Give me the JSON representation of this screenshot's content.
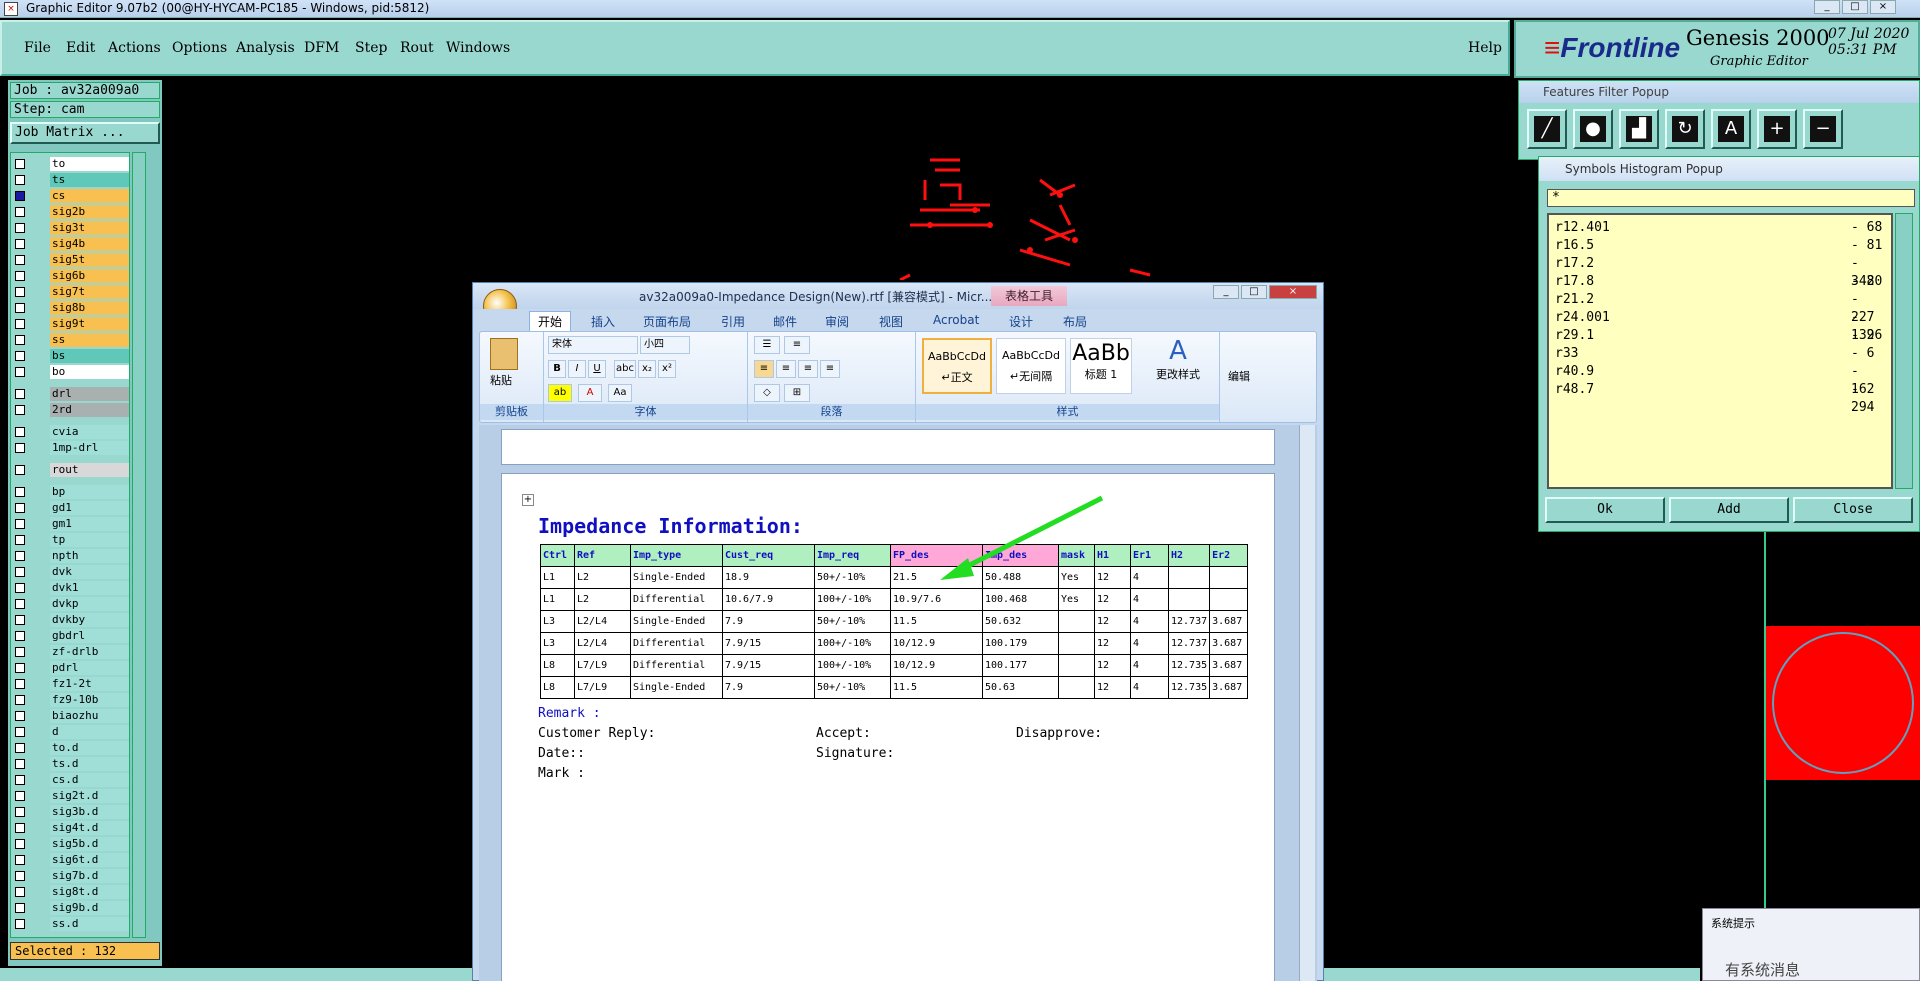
{
  "window": {
    "title": "Graphic Editor 9.07b2 (00@HY-HYCAM-PC185 - Windows, pid:5812)"
  },
  "menubar": {
    "items": [
      "File",
      "Edit",
      "Actions",
      "Options",
      "Analysis",
      "DFM",
      "Step",
      "Rout",
      "Windows"
    ],
    "help": "Help"
  },
  "brand": {
    "logo": "Frontline",
    "product": "Genesis 2000",
    "subtitle": "Graphic Editor",
    "date": "07 Jul 2020",
    "time": "05:31 PM"
  },
  "left": {
    "job": "Job : av32a009a0",
    "step": "Step: cam",
    "matrix": "Job Matrix ...",
    "selected": "Selected : 132",
    "layers": [
      {
        "name": "to",
        "color": "white",
        "mark": "⬋"
      },
      {
        "name": "ts",
        "color": "teal",
        "mark": ""
      },
      {
        "name": "cs",
        "color": "org",
        "mark": "≡",
        "on": true
      },
      {
        "name": "sig2b",
        "color": "org",
        "mark": ""
      },
      {
        "name": "sig3t",
        "color": "org",
        "mark": ""
      },
      {
        "name": "sig4b",
        "color": "org",
        "mark": ""
      },
      {
        "name": "sig5t",
        "color": "org",
        "mark": "⬋"
      },
      {
        "name": "sig6b",
        "color": "org",
        "mark": "⬋"
      },
      {
        "name": "sig7t",
        "color": "org",
        "mark": ""
      },
      {
        "name": "sig8b",
        "color": "org",
        "mark": ""
      },
      {
        "name": "sig9t",
        "color": "org",
        "mark": ""
      },
      {
        "name": "ss",
        "color": "org",
        "mark": ""
      },
      {
        "name": "bs",
        "color": "teal",
        "mark": ""
      },
      {
        "name": "bo",
        "color": "white",
        "mark": "⬋"
      },
      {
        "name": "drl",
        "color": "grey",
        "mark": ""
      },
      {
        "name": "2rd",
        "color": "grey",
        "mark": ""
      },
      {
        "name": "cvia",
        "color": "cyan",
        "mark": ""
      },
      {
        "name": "1mp-drl",
        "color": "cyan",
        "mark": ""
      },
      {
        "name": "rout",
        "color": "lgrey",
        "mark": ""
      },
      {
        "name": "bp",
        "color": "cyan",
        "mark": ""
      },
      {
        "name": "gd1",
        "color": "cyan",
        "mark": "⬋"
      },
      {
        "name": "gm1",
        "color": "cyan",
        "mark": ""
      },
      {
        "name": "tp",
        "color": "cyan",
        "mark": ""
      },
      {
        "name": "npth",
        "color": "cyan",
        "mark": ""
      },
      {
        "name": "dvk",
        "color": "cyan",
        "mark": ""
      },
      {
        "name": "dvk1",
        "color": "cyan",
        "mark": ""
      },
      {
        "name": "dvkp",
        "color": "cyan",
        "mark": ""
      },
      {
        "name": "dvkby",
        "color": "cyan",
        "mark": ""
      },
      {
        "name": "gbdrl",
        "color": "cyan",
        "mark": ""
      },
      {
        "name": "zf-drlb",
        "color": "cyan",
        "mark": ""
      },
      {
        "name": "pdrl",
        "color": "cyan",
        "mark": ""
      },
      {
        "name": "fz1-2t",
        "color": "cyan",
        "mark": ""
      },
      {
        "name": "fz9-10b",
        "color": "cyan",
        "mark": ""
      },
      {
        "name": "biaozhu",
        "color": "cyan",
        "mark": ""
      },
      {
        "name": "d",
        "color": "cyan",
        "mark": ""
      },
      {
        "name": "to.d",
        "color": "cyan",
        "mark": "⬋"
      },
      {
        "name": "ts.d",
        "color": "cyan",
        "mark": ""
      },
      {
        "name": "cs.d",
        "color": "cyan",
        "mark": ""
      },
      {
        "name": "sig2t.d",
        "color": "cyan",
        "mark": ""
      },
      {
        "name": "sig3b.d",
        "color": "cyan",
        "mark": ""
      },
      {
        "name": "sig4t.d",
        "color": "cyan",
        "mark": ""
      },
      {
        "name": "sig5b.d",
        "color": "cyan",
        "mark": "⬋"
      },
      {
        "name": "sig6t.d",
        "color": "cyan",
        "mark": "⬋"
      },
      {
        "name": "sig7b.d",
        "color": "cyan",
        "mark": ""
      },
      {
        "name": "sig8t.d",
        "color": "cyan",
        "mark": ""
      },
      {
        "name": "sig9b.d",
        "color": "cyan",
        "mark": ""
      },
      {
        "name": "ss.d",
        "color": "cyan",
        "mark": ""
      }
    ]
  },
  "word": {
    "doc_title": "av32a009a0-Impedance Design(New).rtf [兼容模式] - Micr...",
    "context_tab": "表格工具",
    "tabs": [
      "开始",
      "插入",
      "页面布局",
      "引用",
      "邮件",
      "审阅",
      "视图",
      "Acrobat",
      "设计",
      "布局"
    ],
    "ribbon": {
      "paste": "粘贴",
      "clipboard": "剪贴板",
      "font_name": "宋体",
      "font_size": "小四",
      "font_group": "字体",
      "para_group": "段落",
      "styles_group": "样式",
      "style1_preview": "AaBbCcDd",
      "style1_name": "↵正文",
      "style2_preview": "AaBbCcDd",
      "style2_name": "↵无间隔",
      "style3_preview": "AaBb",
      "style3_name": "标题 1",
      "change_styles": "更改样式",
      "edit": "编辑"
    },
    "heading": "Impedance Information:",
    "table_headers": [
      "Ctrl",
      "Ref",
      "Imp_type",
      "Cust_req",
      "Imp_req",
      "FP_des",
      "Imp_des",
      "mask",
      "H1",
      "Er1",
      "H2",
      "Er2"
    ],
    "table_rows": [
      [
        "L1",
        "L2",
        "Single-Ended",
        "18.9",
        "50+/-10%",
        "21.5",
        "50.488",
        "Yes",
        "12",
        "4",
        "",
        ""
      ],
      [
        "L1",
        "L2",
        "Differential",
        "10.6/7.9",
        "100+/-10%",
        "10.9/7.6",
        "100.468",
        "Yes",
        "12",
        "4",
        "",
        ""
      ],
      [
        "L3",
        "L2/L4",
        "Single-Ended",
        "7.9",
        "50+/-10%",
        "11.5",
        "50.632",
        "",
        "12",
        "4",
        "12.737",
        "3.687"
      ],
      [
        "L3",
        "L2/L4",
        "Differential",
        "7.9/15",
        "100+/-10%",
        "10/12.9",
        "100.179",
        "",
        "12",
        "4",
        "12.737",
        "3.687"
      ],
      [
        "L8",
        "L7/L9",
        "Differential",
        "7.9/15",
        "100+/-10%",
        "10/12.9",
        "100.177",
        "",
        "12",
        "4",
        "12.735",
        "3.687"
      ],
      [
        "L8",
        "L7/L9",
        "Single-Ended",
        "7.9",
        "50+/-10%",
        "11.5",
        "50.63",
        "",
        "12",
        "4",
        "12.735",
        "3.687"
      ]
    ],
    "remark": "Remark :",
    "customer_reply": "Customer Reply:",
    "accept": "Accept:",
    "disapprove": "Disapprove:",
    "date": "Date::",
    "signature": "Signature:",
    "mark": "Mark :"
  },
  "features_popup": {
    "title": "Features Filter Popup"
  },
  "symbols_popup": {
    "title": "Symbols Histogram Popup",
    "filter": "*",
    "items": [
      {
        "sym": "r12.401",
        "count": "- 68"
      },
      {
        "sym": "r16.5",
        "count": "- 81"
      },
      {
        "sym": "r17.2",
        "count": "- 342"
      },
      {
        "sym": "r17.8",
        "count": "- 80"
      },
      {
        "sym": "r21.2",
        "count": "- 227"
      },
      {
        "sym": "r24.001",
        "count": "- 132"
      },
      {
        "sym": "r29.1",
        "count": "- 96"
      },
      {
        "sym": "r33",
        "count": "- 6"
      },
      {
        "sym": "r40.9",
        "count": "- 162"
      },
      {
        "sym": "r48.7",
        "count": "- 294"
      }
    ],
    "ok": "Ok",
    "add": "Add",
    "close": "Close"
  },
  "notification": {
    "title": "系统提示",
    "body": "有系统消息"
  },
  "colors": {
    "panel": "#99d8cf",
    "canvas": "#000000",
    "arrow": "#22dd22",
    "pcb_red": "#ff1010"
  }
}
